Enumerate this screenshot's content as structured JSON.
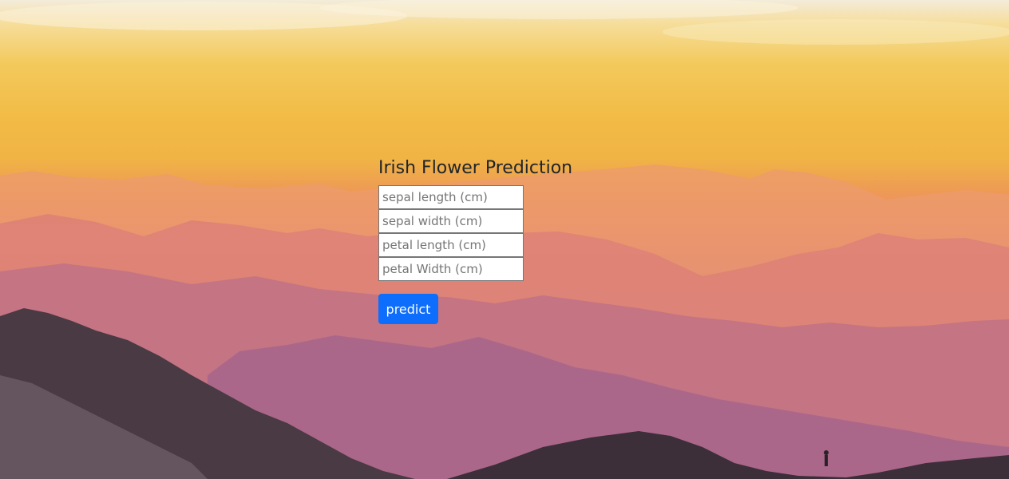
{
  "page": {
    "title": "Irish Flower Prediction"
  },
  "form": {
    "fields": [
      {
        "placeholder": "sepal length (cm)",
        "value": ""
      },
      {
        "placeholder": "sepal width (cm)",
        "value": ""
      },
      {
        "placeholder": "petal length (cm)",
        "value": ""
      },
      {
        "placeholder": "petal Width (cm)",
        "value": ""
      }
    ],
    "submit_label": "predict"
  },
  "colors": {
    "button": "#0d6efd",
    "title_text": "#212529",
    "sky_top": "#f3ecd9",
    "sky_mid": "#f2bb45",
    "mountains": "#9a6088"
  }
}
